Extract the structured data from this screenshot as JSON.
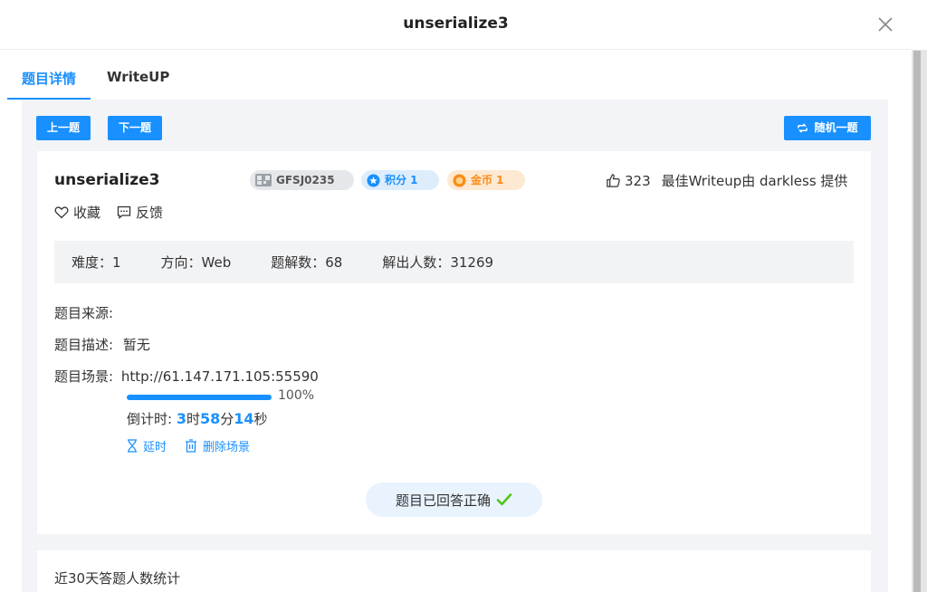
{
  "drawer": {
    "title": "unserialize3"
  },
  "tabs": [
    {
      "label": "题目详情",
      "active": true
    },
    {
      "label": "WriteUP",
      "active": false
    }
  ],
  "nav": {
    "prev_label": "上一题",
    "next_label": "下一题",
    "random_label": "随机一题"
  },
  "challenge": {
    "name": "unserialize3",
    "tags": {
      "id": "GFSJ0235",
      "score": "积分 1",
      "coin": "金币 1"
    },
    "likes": "323",
    "best_writeup": "最佳Writeup由 darkless 提供",
    "favorite_label": "收藏",
    "feedback_label": "反馈",
    "stats": {
      "difficulty": "难度：1",
      "direction": "方向：Web",
      "solves": "题解数：68",
      "solvers": "解出人数：31269"
    },
    "source_label": "题目来源:",
    "description_label": "题目描述:",
    "description_value": "暂无",
    "scene_label": "题目场景:",
    "scene_url": "http://61.147.171.105:55590",
    "progress": 1.0,
    "progress_text": "100%",
    "countdown": {
      "label": "倒计时:",
      "hours": "3",
      "h_unit": "时",
      "minutes": "58",
      "m_unit": "分",
      "seconds": "14",
      "s_unit": "秒"
    },
    "extend_label": "延时",
    "delete_label": "删除场景",
    "solved_label": "题目已回答正确"
  },
  "stats_card": {
    "title": "近30天答题人数统计"
  },
  "colors": {
    "accent": "#1890ff",
    "success": "#52c41a",
    "coin": "#fa8c16"
  }
}
